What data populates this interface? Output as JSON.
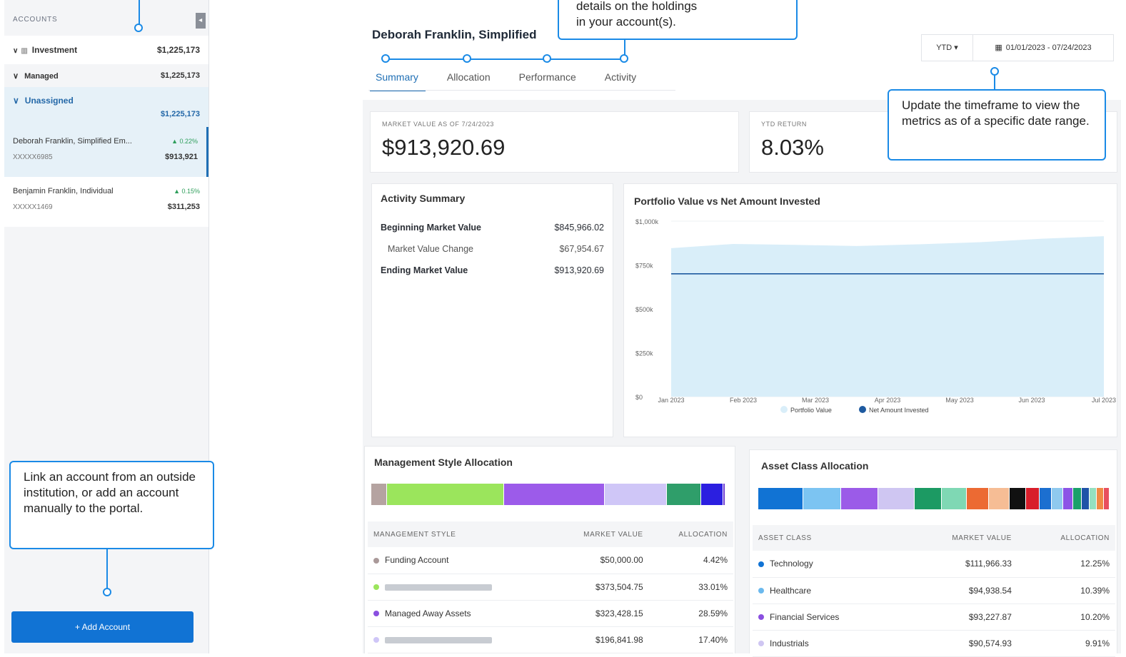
{
  "sidebar": {
    "header": "ACCOUNTS",
    "collapse_icon": "chevron-left-icon",
    "investment": {
      "label": "Investment",
      "value": "$1,225,173"
    },
    "managed": {
      "label": "Managed",
      "value": "$1,225,173"
    },
    "unassigned": {
      "label": "Unassigned",
      "value": "$1,225,173"
    },
    "accounts": [
      {
        "name": "Deborah Franklin, Simplified Em...",
        "change": "▲ 0.22%",
        "number": "XXXXX6985",
        "value": "$913,921"
      },
      {
        "name": "Benjamin Franklin, Individual",
        "change": "▲ 0.15%",
        "number": "XXXXX1469",
        "value": "$311,253"
      }
    ],
    "add_button": "+ Add Account"
  },
  "header": {
    "title": "Deborah Franklin, Simplified",
    "tabs": [
      "Summary",
      "Allocation",
      "Performance",
      "Activity"
    ],
    "timeframe": "YTD ▾",
    "date_range": "01/01/2023 - 07/24/2023"
  },
  "metrics": {
    "market_value_label": "MARKET VALUE AS OF 7/24/2023",
    "market_value": "$913,920.69",
    "ytd_label": "YTD RETURN",
    "ytd_value": "8.03%"
  },
  "activity": {
    "title": "Activity Summary",
    "rows": [
      {
        "label": "Beginning Market Value",
        "value": "$845,966.02"
      },
      {
        "label": "Market Value Change",
        "value": "$67,954.67"
      },
      {
        "label": "Ending Market Value",
        "value": "$913,920.69"
      }
    ]
  },
  "chart_data": {
    "type": "area",
    "title": "Portfolio Value vs Net Amount Invested",
    "x_labels": [
      "Jan 2023",
      "Feb 2023",
      "Mar 2023",
      "Apr 2023",
      "May 2023",
      "Jun 2023",
      "Jul 2023"
    ],
    "y_ticks": [
      "$0",
      "$250k",
      "$500k",
      "$750k",
      "$1,000k"
    ],
    "ylim": [
      0,
      1000000
    ],
    "series": [
      {
        "name": "Portfolio Value",
        "color": "#d9eef9",
        "values": [
          845966,
          870000,
          865000,
          858000,
          868000,
          880000,
          900000,
          913920
        ]
      },
      {
        "name": "Net Amount Invested",
        "color": "#1e5aa0",
        "values": [
          700000,
          700000,
          700000,
          700000,
          700000,
          700000,
          700000,
          700000
        ]
      }
    ],
    "legend": "bottom"
  },
  "management": {
    "title": "Management Style Allocation",
    "columns": [
      "MANAGEMENT STYLE",
      "MARKET VALUE",
      "ALLOCATION"
    ],
    "bar": [
      {
        "color": "#b5a3a1",
        "pct": 4.42
      },
      {
        "color": "#9be55c",
        "pct": 33.01
      },
      {
        "color": "#9c5bea",
        "pct": 28.59
      },
      {
        "color": "#cfc6f7",
        "pct": 17.4
      },
      {
        "color": "#2f9e6a",
        "pct": 9.8
      },
      {
        "color": "#2b1fe0",
        "pct": 6.2
      },
      {
        "color": "#6b3bd1",
        "pct": 0.58
      }
    ],
    "rows": [
      {
        "label": "Funding Account",
        "value": "$50,000.00",
        "alloc": "4.42%",
        "color": "#a99"
      },
      {
        "label": "",
        "value": "$373,504.75",
        "alloc": "33.01%",
        "color": "#9be55c"
      },
      {
        "label": "Managed Away Assets",
        "value": "$323,428.15",
        "alloc": "28.59%",
        "color": "#8a4fe0"
      },
      {
        "label": "",
        "value": "$196,841.98",
        "alloc": "17.40%",
        "color": "#cfc6f7"
      }
    ]
  },
  "asset_class": {
    "title": "Asset Class Allocation",
    "columns": [
      "ASSET CLASS",
      "MARKET VALUE",
      "ALLOCATION"
    ],
    "bar": [
      {
        "color": "#1173d4",
        "pct": 12.25
      },
      {
        "color": "#7cc4f2",
        "pct": 10.39
      },
      {
        "color": "#9b5be8",
        "pct": 10.2
      },
      {
        "color": "#cfc6f2",
        "pct": 9.91
      },
      {
        "color": "#1c9a63",
        "pct": 7.5
      },
      {
        "color": "#7fd8b4",
        "pct": 6.8
      },
      {
        "color": "#ec6a33",
        "pct": 6.0
      },
      {
        "color": "#f6bd95",
        "pct": 5.8
      },
      {
        "color": "#111111",
        "pct": 4.5
      },
      {
        "color": "#d81e2b",
        "pct": 3.6
      },
      {
        "color": "#1c6fd0",
        "pct": 3.4
      },
      {
        "color": "#8fc9ee",
        "pct": 3.2
      },
      {
        "color": "#8c54e6",
        "pct": 2.6
      },
      {
        "color": "#1aa06a",
        "pct": 2.4
      },
      {
        "color": "#1f53a8",
        "pct": 2.2
      },
      {
        "color": "#95e0c0",
        "pct": 2.0
      },
      {
        "color": "#f08a45",
        "pct": 1.8
      },
      {
        "color": "#e84f5e",
        "pct": 1.6
      }
    ],
    "rows": [
      {
        "label": "Technology",
        "value": "$111,966.33",
        "alloc": "12.25%",
        "color": "#1173d4"
      },
      {
        "label": "Healthcare",
        "value": "$94,938.54",
        "alloc": "10.39%",
        "color": "#6bb9ee"
      },
      {
        "label": "Financial Services",
        "value": "$93,227.87",
        "alloc": "10.20%",
        "color": "#8a4fe0"
      },
      {
        "label": "Industrials",
        "value": "$90,574.93",
        "alloc": "9.91%",
        "color": "#cfc6f2"
      }
    ]
  },
  "callouts": {
    "tabs_tip_line1": "details on the holdings",
    "tabs_tip_line2": "in your account(s).",
    "timeframe_tip": "Update the timeframe to view the metrics as of a specific date range.",
    "link_tip": "Link an account from an outside institution, or add an account manually to the portal."
  }
}
